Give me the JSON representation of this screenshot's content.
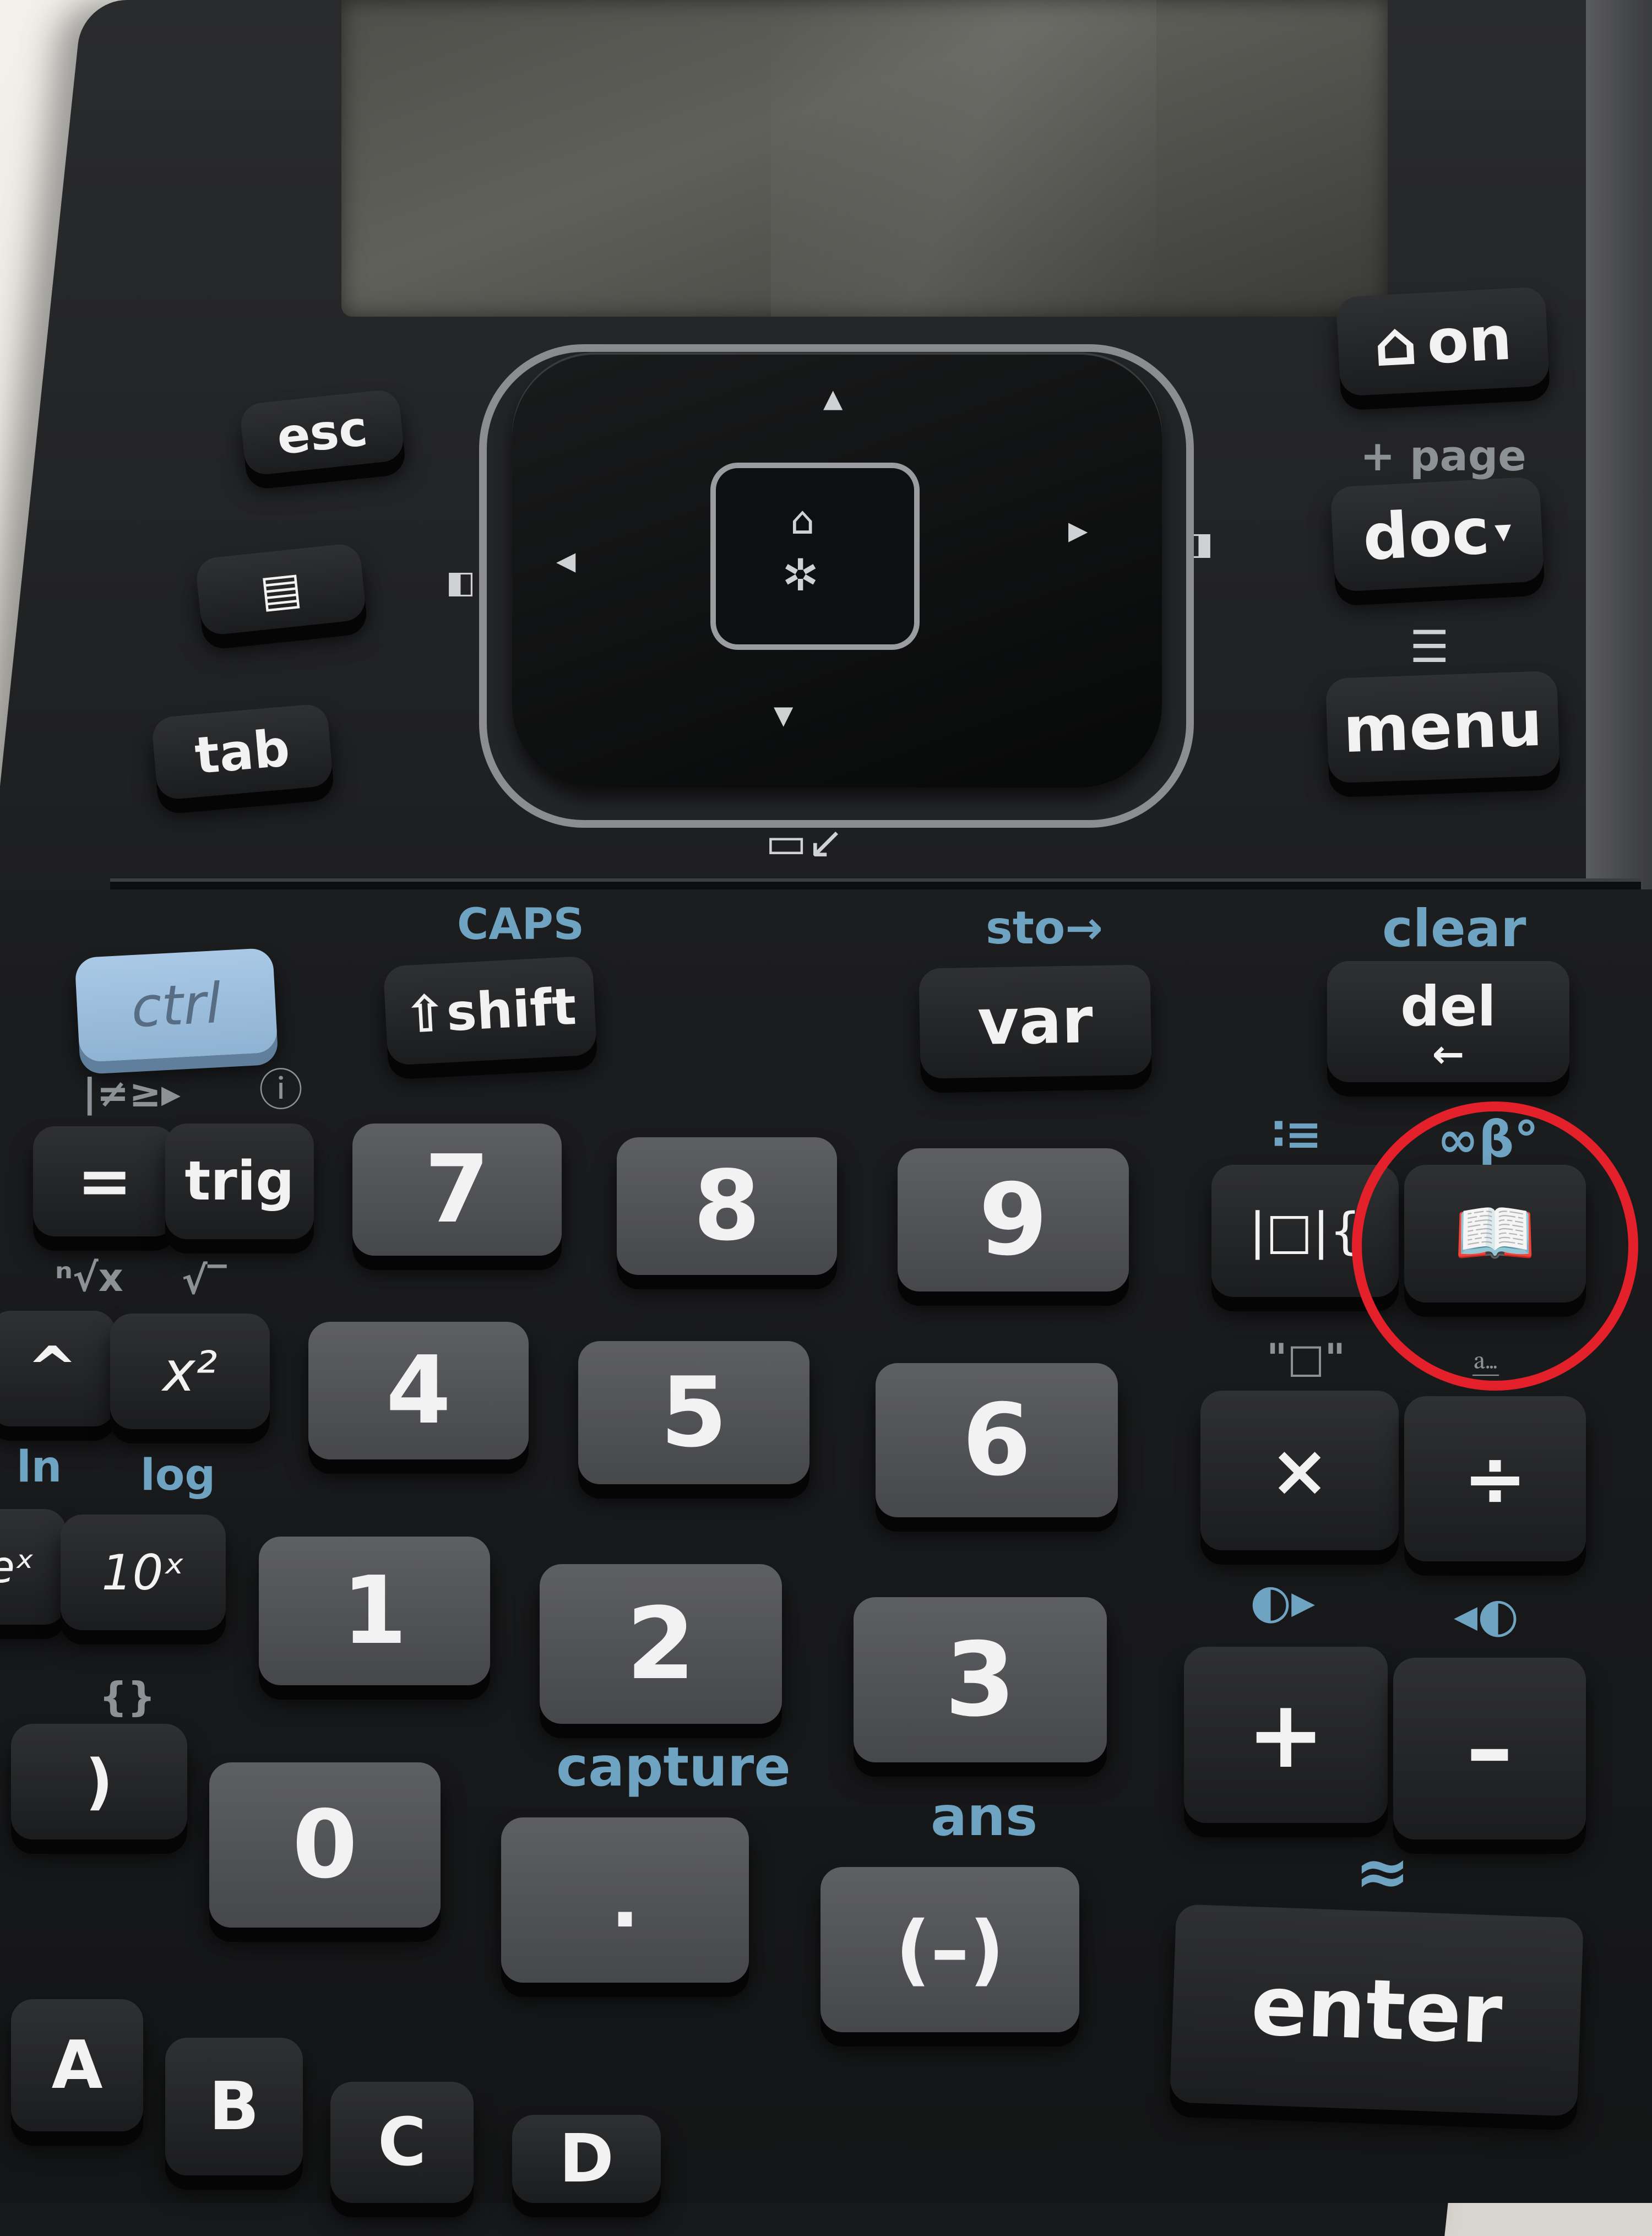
{
  "nav_keys": {
    "esc": "esc",
    "tab": "tab",
    "on": "on",
    "doc": "doc",
    "doc_arrow": "▾",
    "doc_upper": "+ page",
    "menu": "menu"
  },
  "modifier_keys": {
    "ctrl": "ctrl",
    "shift": "shift",
    "shift_upper": "CAPS",
    "var": "var",
    "var_upper": "sto→",
    "del": "del",
    "del_arrow": "←",
    "del_upper": "clear"
  },
  "function_keys": {
    "equals": "=",
    "trig": "trig",
    "trig_upper": "|≠≥▸",
    "caret": "^",
    "square": "x²",
    "caret_upper": "ⁿ√x",
    "square_upper": "√‾",
    "ln_upper": "ln",
    "log_upper": "log",
    "tenx": "10ˣ",
    "ex": "eˣ",
    "paren_close": ")",
    "braces_upper": "{}",
    "templates": "|□|{",
    "templates_upper": "∶≡",
    "catalog_upper": "∞β°",
    "times_upper": "\"□\"",
    "plus_upper": "◐▸",
    "minus_upper": "◂◐"
  },
  "digit_keys": [
    "7",
    "8",
    "9",
    "4",
    "5",
    "6",
    "1",
    "2",
    "3",
    "0"
  ],
  "misc_keys": {
    "decimal": ".",
    "decimal_upper": "capture",
    "negative": "(–)",
    "negative_upper": "ans",
    "enter": "enter",
    "enter_upper": "≈"
  },
  "operator_keys": {
    "times": "×",
    "divide": "÷",
    "plus": "+",
    "minus": "–"
  },
  "letter_keys": [
    "A",
    "B",
    "C",
    "D"
  ],
  "highlight": {
    "color": "#e4202a",
    "target": "catalog-key"
  }
}
